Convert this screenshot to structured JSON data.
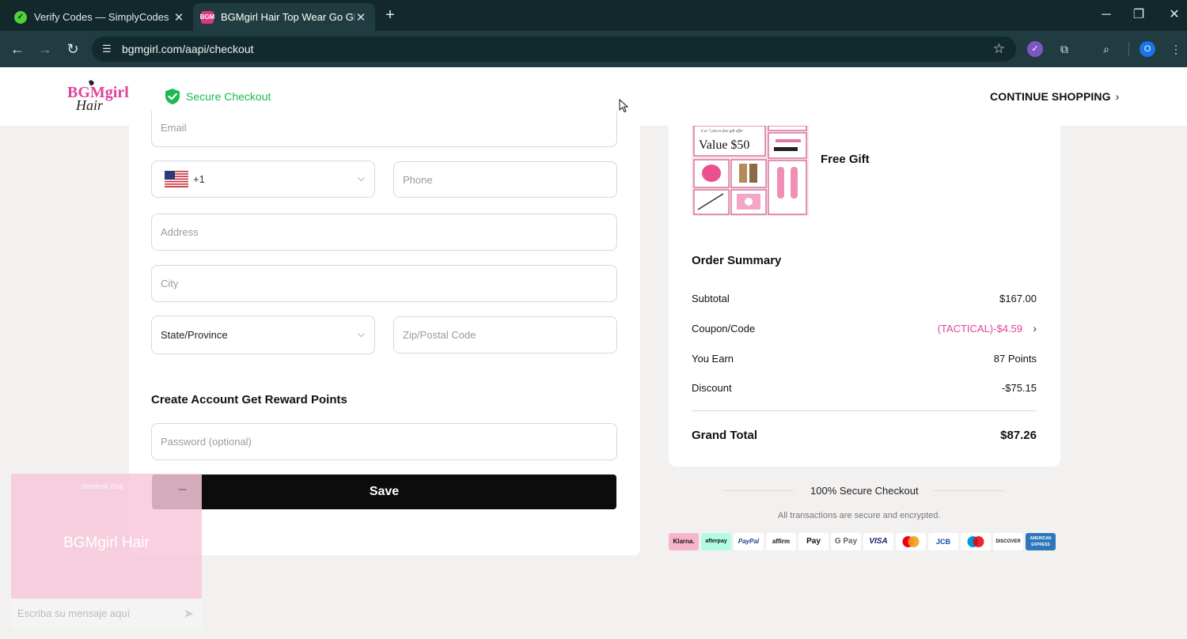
{
  "browser": {
    "tabs": [
      {
        "title": "Verify Codes — SimplyCodes",
        "active": false,
        "favicon": "simplycodes-check-icon"
      },
      {
        "title": "BGMgirl Hair Top Wear Go Glue",
        "active": true,
        "favicon": "bgm-favicon"
      }
    ],
    "url": "bgmgirl.com/aapi/checkout",
    "profile_initial": "O"
  },
  "header": {
    "secure_checkout": "Secure Checkout",
    "continue_shopping": "CONTINUE SHOPPING",
    "logo_icon": "bgmgirl-hair-logo"
  },
  "form": {
    "email_placeholder": "Email",
    "phone_code": "+1",
    "phone_placeholder": "Phone",
    "address_placeholder": "Address",
    "city_placeholder": "City",
    "state_value": "State/Province",
    "zip_placeholder": "Zip/Postal Code",
    "account_title": "Create Account Get Reward Points",
    "password_placeholder": "Password (optional)",
    "save_label": "Save"
  },
  "gift": {
    "label": "Free Gift",
    "image_caption": "6 or 7 pieces free gift offer",
    "image_value": "Value $50"
  },
  "summary": {
    "title": "Order Summary",
    "subtotal_label": "Subtotal",
    "subtotal_value": "$167.00",
    "coupon_label": "Coupon/Code",
    "coupon_value": "(TACTICAL)-$4.59",
    "earn_label": "You Earn",
    "earn_value": "87 Points",
    "discount_label": "Discount",
    "discount_value": "-$75.15",
    "grand_total_label": "Grand Total",
    "grand_total_value": "$87.26"
  },
  "security": {
    "title": "100% Secure Checkout",
    "note": "All transactions are secure and encrypted."
  },
  "payments": [
    "Klarna.",
    "afterpay",
    "PayPal",
    "affirm",
    "Pay",
    "G Pay",
    "VISA",
    "mastercard",
    "JCB",
    "maestro",
    "DISCOVER",
    "AMERICAN EXPRESS"
  ],
  "chat": {
    "brand": "zendesk chat",
    "name": "BGMgirl Hair",
    "input_placeholder": "Escriba su mensaje aquí"
  },
  "colors": {
    "accent_pink": "#e0439b",
    "secure_green": "#1db954",
    "save_button": "#0c0c0c",
    "chat_pink": "#f7c8db"
  }
}
